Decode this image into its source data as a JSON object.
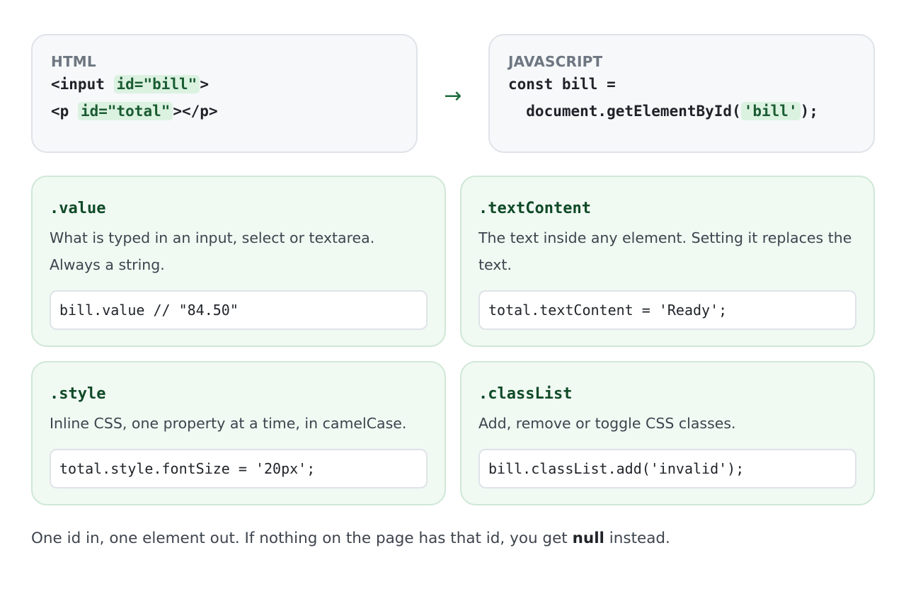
{
  "html_card": {
    "label": "HTML",
    "line1": {
      "pre": "<input ",
      "hl": "id=\"bill\"",
      "post": ">"
    },
    "line2": {
      "pre": "<p ",
      "hl": "id=\"total\"",
      "post": "></p>"
    }
  },
  "arrow": "→",
  "js_card": {
    "label": "JAVASCRIPT",
    "line1": "const bill =",
    "line2": {
      "pre": "  document.getElementById(",
      "hl": "'bill'",
      "post": ");"
    }
  },
  "cards": [
    {
      "title": ".value",
      "description": "What is typed in an input, select or textarea. Always a string.",
      "code": "bill.value // \"84.50\""
    },
    {
      "title": ".textContent",
      "description": "The text inside any element. Setting it replaces the text.",
      "code": "total.textContent = 'Ready';"
    },
    {
      "title": ".style",
      "description": "Inline CSS, one property at a time, in camelCase.",
      "code": "total.style.fontSize = '20px';"
    },
    {
      "title": ".classList",
      "description": "Add, remove or toggle CSS classes.",
      "code": "bill.classList.add('invalid');"
    }
  ],
  "footer": {
    "pre": "One id in, one element out. If nothing on the page has that id, you get ",
    "bold": "null",
    "post": " instead."
  },
  "colors": {
    "accent": "#0f4a27",
    "highlight_bg": "#dcf2e1",
    "card_bg": "#f1f9f3",
    "card_border": "#cfe8d6"
  }
}
